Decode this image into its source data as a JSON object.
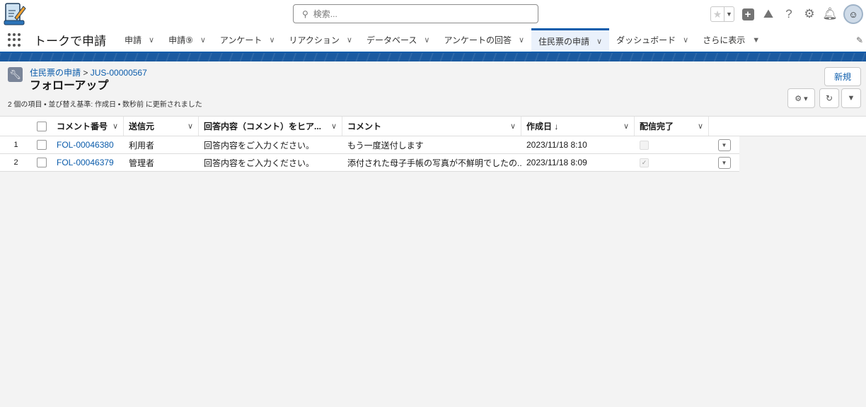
{
  "header": {
    "search_placeholder": "検索..."
  },
  "nav": {
    "app_name": "トークで申請",
    "tabs": [
      {
        "label": "申請"
      },
      {
        "label": "申請⑨"
      },
      {
        "label": "アンケート"
      },
      {
        "label": "リアクション"
      },
      {
        "label": "データベース"
      },
      {
        "label": "アンケートの回答"
      },
      {
        "label": "住民票の申請",
        "active": true
      },
      {
        "label": "ダッシュボード"
      }
    ],
    "more": "さらに表示"
  },
  "page": {
    "breadcrumb_parent": "住民票の申請",
    "breadcrumb_sep": ">",
    "breadcrumb_record": "JUS-00000567",
    "title": "フォローアップ",
    "summary": "2 個の項目 • 並び替え基準: 作成日 • 数秒前 に更新されました",
    "new_button": "新規"
  },
  "table": {
    "columns": [
      "コメント番号",
      "送信元",
      "回答内容（コメント）をヒア...",
      "コメント",
      "作成日 ↓",
      "配信完了"
    ],
    "rows": [
      {
        "num": "1",
        "id": "FOL-00046380",
        "sender": "利用者",
        "answer": "回答内容をご入力ください。",
        "comment": "もう一度送付します",
        "created": "2023/11/18 8:10",
        "delivered": false
      },
      {
        "num": "2",
        "id": "FOL-00046379",
        "sender": "管理者",
        "answer": "回答内容をご入力ください。",
        "comment": "添付された母子手帳の写真が不鮮明でしたの...",
        "created": "2023/11/18 8:09",
        "delivered": true
      }
    ]
  },
  "colors": {
    "brand": "#0b5cab",
    "band": "#1b5aa0"
  }
}
